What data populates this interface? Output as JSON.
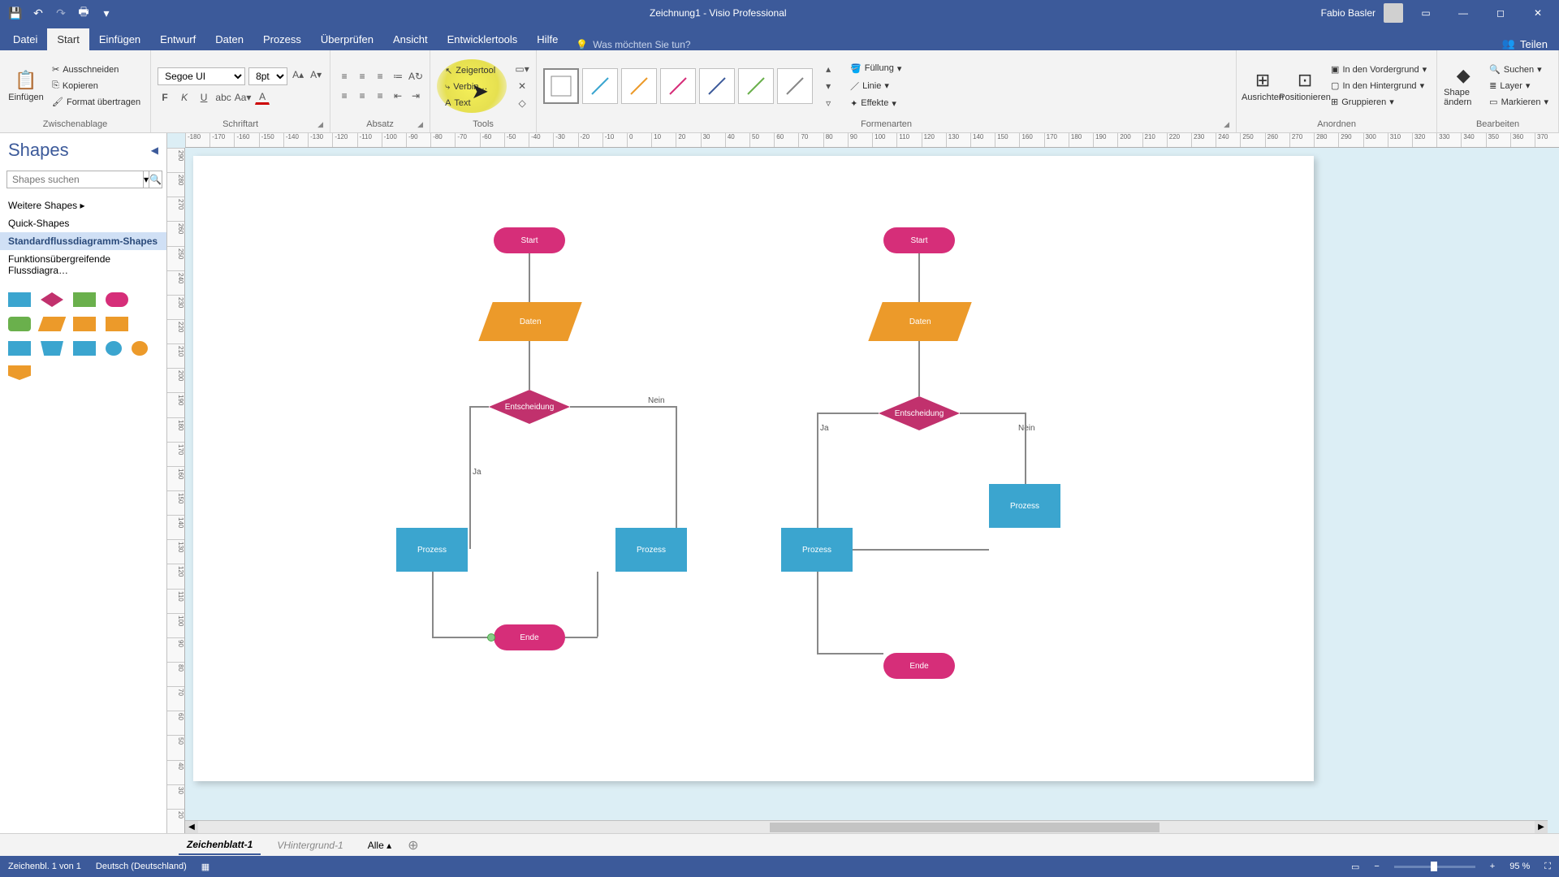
{
  "title": "Zeichnung1 - Visio Professional",
  "user_name": "Fabio Basler",
  "tabs": {
    "datei": "Datei",
    "start": "Start",
    "einfugen": "Einfügen",
    "entwurf": "Entwurf",
    "daten": "Daten",
    "prozess": "Prozess",
    "uberprufen": "Überprüfen",
    "ansicht": "Ansicht",
    "entwicklertools": "Entwicklertools",
    "hilfe": "Hilfe"
  },
  "tellme_placeholder": "Was möchten Sie tun?",
  "share": "Teilen",
  "ribbon": {
    "paste": "Einfügen",
    "cut": "Ausschneiden",
    "copy": "Kopieren",
    "format_painter": "Format übertragen",
    "clipboard_label": "Zwischenablage",
    "font_name": "Segoe UI",
    "font_size": "8pt.",
    "font_label": "Schriftart",
    "absatz_label": "Absatz",
    "tools": {
      "pointer": "Zeigertool",
      "connector": "Verbin…",
      "text": "Text",
      "label": "Tools"
    },
    "formenarten_label": "Formenarten",
    "fill": "Füllung",
    "line": "Linie",
    "effects": "Effekte",
    "align": "Ausrichten",
    "position": "Positionieren",
    "foreground": "In den Vordergrund",
    "background": "In den Hintergrund",
    "group": "Gruppieren",
    "anordnen_label": "Anordnen",
    "shape_andern": "Shape ändern",
    "find": "Suchen",
    "layer": "Layer",
    "select_mark": "Markieren",
    "bearbeiten_label": "Bearbeiten"
  },
  "shapes_panel": {
    "title": "Shapes",
    "search_placeholder": "Shapes suchen",
    "more_shapes": "Weitere Shapes",
    "quick": "Quick-Shapes",
    "standard": "Standardflussdiagramm-Shapes",
    "cross": "Funktionsübergreifende Flussdiagra…"
  },
  "flowchart": {
    "start": "Start",
    "daten": "Daten",
    "entscheidung": "Entscheidung",
    "prozess": "Prozess",
    "ende": "Ende",
    "ja": "Ja",
    "nein": "Nein"
  },
  "ruler_h": [
    "-180",
    "-170",
    "-160",
    "-150",
    "-140",
    "-130",
    "-120",
    "-110",
    "-100",
    "-90",
    "-80",
    "-70",
    "-60",
    "-50",
    "-40",
    "-30",
    "-20",
    "-10",
    "0",
    "10",
    "20",
    "30",
    "40",
    "50",
    "60",
    "70",
    "80",
    "90",
    "100",
    "110",
    "120",
    "130",
    "140",
    "150",
    "160",
    "170",
    "180",
    "190",
    "200",
    "210",
    "220",
    "230",
    "240",
    "250",
    "260",
    "270",
    "280",
    "290",
    "300",
    "310",
    "320",
    "330",
    "340",
    "350",
    "360",
    "370"
  ],
  "ruler_v": [
    "290",
    "280",
    "270",
    "260",
    "250",
    "240",
    "230",
    "220",
    "210",
    "200",
    "190",
    "180",
    "170",
    "160",
    "150",
    "140",
    "130",
    "120",
    "110",
    "100",
    "90",
    "80",
    "70",
    "60",
    "50",
    "40",
    "30",
    "20"
  ],
  "page_tabs": {
    "page1": "Zeichenblatt-1",
    "bg": "VHintergrund-1",
    "all": "Alle"
  },
  "statusbar": {
    "page_info": "Zeichenbl. 1 von 1",
    "lang": "Deutsch (Deutschland)",
    "zoom": "95 %"
  }
}
